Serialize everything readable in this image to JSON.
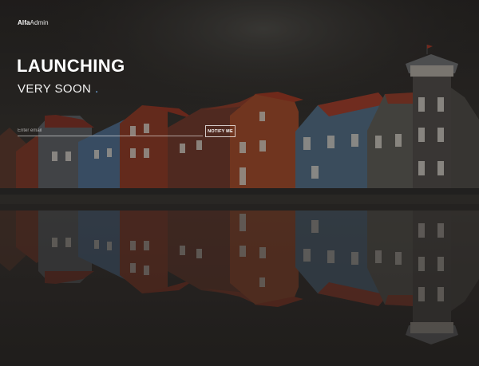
{
  "brand": {
    "bold_part": "Alfa",
    "light_part": "Admin"
  },
  "hero": {
    "title": "LAUNCHING",
    "subtitle": "VERY SOON",
    "subtitle_dot": "."
  },
  "signup": {
    "email_placeholder": "Enter email",
    "notify_label": "NOTIFY ME"
  },
  "colors": {
    "accent_dot": "#6fa3d8",
    "text": "#ffffff"
  }
}
